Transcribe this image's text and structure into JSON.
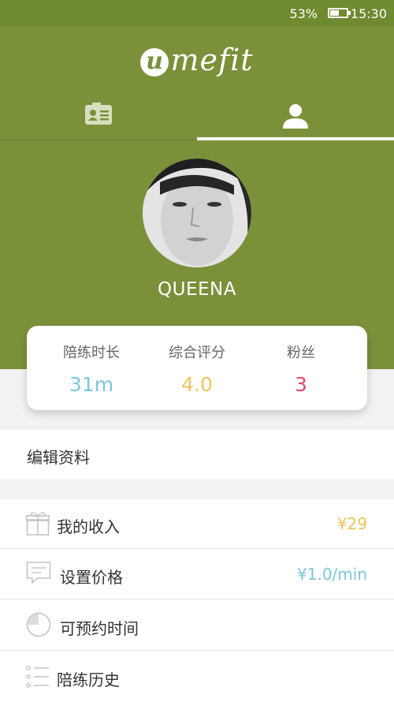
{
  "status_bar": {
    "battery": "53%",
    "time": "15:30"
  },
  "header": {
    "logo_badge": "u",
    "logo_text": "mefit"
  },
  "profile": {
    "name": "QUEENA"
  },
  "stats": [
    {
      "label": "陪练时长",
      "value": "31m",
      "color": "#7ec6dc"
    },
    {
      "label": "综合评分",
      "value": "4.0",
      "color": "#efc45c"
    },
    {
      "label": "粉丝",
      "value": "3",
      "color": "#e14b6a"
    }
  ],
  "edit_profile": {
    "label": "编辑资料"
  },
  "menu": {
    "income": {
      "label": "我的收入",
      "value": "¥29",
      "color": "#efc45c"
    },
    "price": {
      "label": "设置价格",
      "value": "¥1.0/min",
      "color": "#7ec6dc"
    },
    "schedule": {
      "label": "可预约时间"
    },
    "history": {
      "label": "陪练历史"
    }
  }
}
